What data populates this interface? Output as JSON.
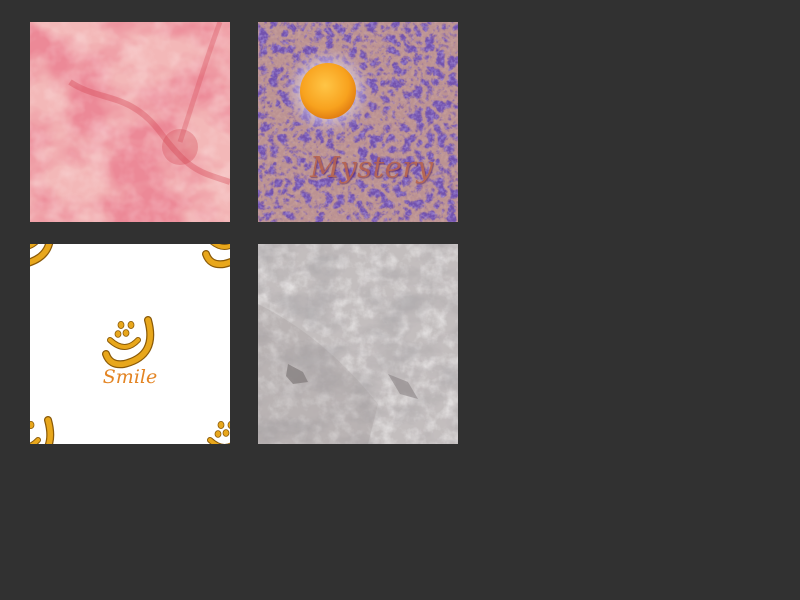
{
  "tiles": {
    "pink": {
      "icon": "pink-marble-texture"
    },
    "mystery": {
      "icon": "purple-texture-sun",
      "label": "Mystery"
    },
    "smile": {
      "icon": "smiley-pattern",
      "label": "Smile"
    },
    "stone": {
      "icon": "gray-stone-texture"
    }
  },
  "colors": {
    "background": "#313131",
    "pink_base": "#f3b7b7",
    "pink_vein": "#d8414f",
    "mystery_base": "#7554b0",
    "mystery_speckle": "#a4623d",
    "sun": "#f7a021",
    "smile_gold": "#e8a71c",
    "smile_text": "#e38423",
    "stone_base": "#c6c1c1"
  }
}
